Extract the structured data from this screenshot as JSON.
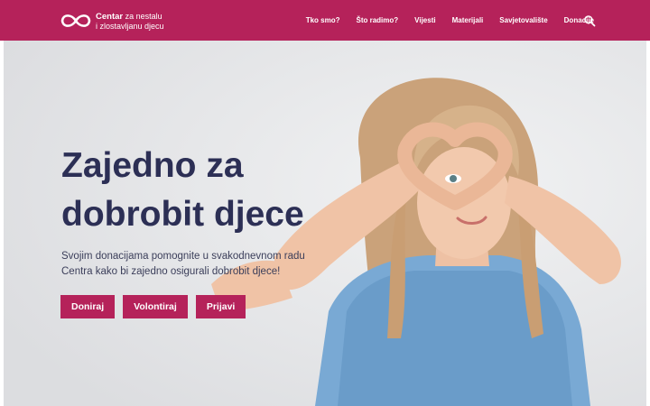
{
  "header": {
    "logo_bold": "Centar",
    "logo_line1_rest": "za nestalu",
    "logo_line2": "i zlostavljanu djecu",
    "nav": [
      {
        "label": "Tko smo?"
      },
      {
        "label": "Što radimo?"
      },
      {
        "label": "Vijesti"
      },
      {
        "label": "Materijali"
      },
      {
        "label": "Savjetovalište"
      },
      {
        "label": "Donacije"
      }
    ],
    "search_icon": "search-icon"
  },
  "hero": {
    "title_line1": "Zajedno za",
    "title_line2": "dobrobit djece",
    "subtitle_line1": "Svojim donacijama pomognite u svakodnevnom radu",
    "subtitle_line2": "Centra kako bi zajedno osigurali dobrobit djece!",
    "buttons": [
      {
        "label": "Doniraj"
      },
      {
        "label": "Volontiraj"
      },
      {
        "label": "Prijavi"
      }
    ]
  },
  "colors": {
    "brand": "#b5225a",
    "title": "#2c2f55",
    "hero_bg": "#e8e9eb"
  }
}
